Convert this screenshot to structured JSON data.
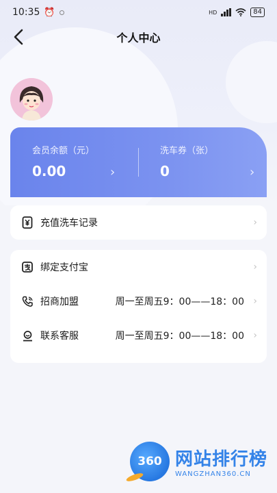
{
  "status_bar": {
    "time": "10:35",
    "battery": "84",
    "network": "HD"
  },
  "header": {
    "title": "个人中心"
  },
  "balance_card": {
    "member_balance_label": "会员余额（元）",
    "member_balance_value": "0.00",
    "coupon_label": "洗车券（张）",
    "coupon_value": "0"
  },
  "menu_primary": [
    {
      "label": "充值洗车记录",
      "icon": "yen-receipt-icon"
    }
  ],
  "menu_secondary": [
    {
      "label": "绑定支付宝",
      "value": "",
      "icon": "alipay-icon"
    },
    {
      "label": "招商加盟",
      "value": "周一至周五9：00——18：00",
      "icon": "phone-icon"
    },
    {
      "label": "联系客服",
      "value": "周一至周五9：00——18：00",
      "icon": "customer-service-icon"
    }
  ],
  "watermark": {
    "badge": "360",
    "main": "网站排行榜",
    "sub": "WANGZHAN360.CN"
  },
  "colors": {
    "card_start": "#6a84ec",
    "card_end": "#8aa0f4",
    "background": "#f4f5fa",
    "watermark": "#2a7de8"
  }
}
